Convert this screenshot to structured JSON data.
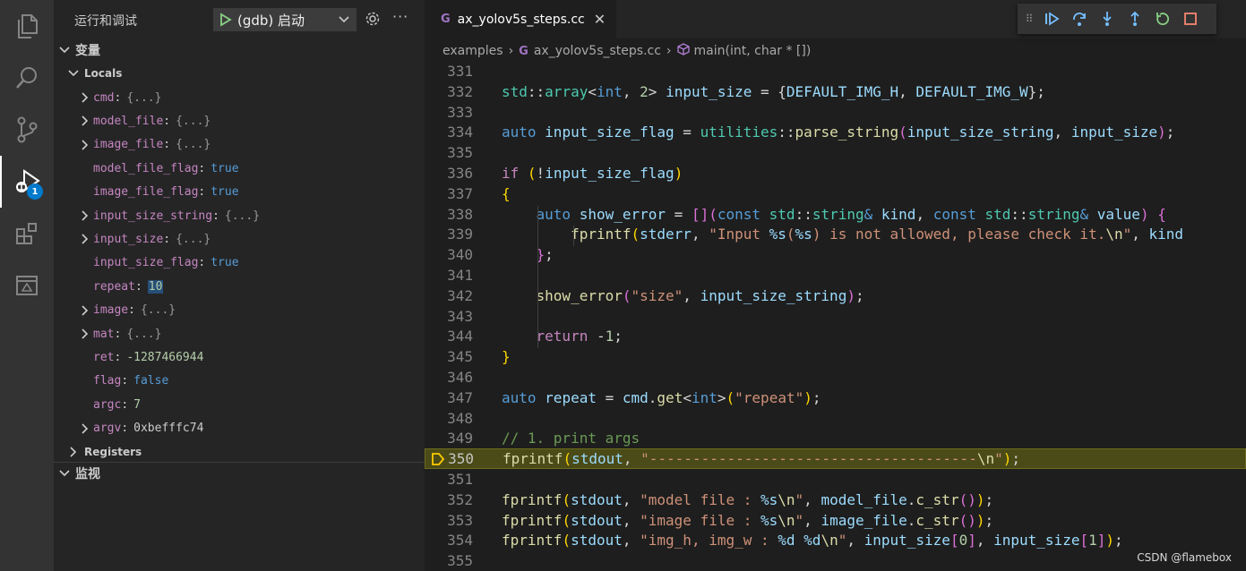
{
  "activity": {
    "icons": [
      "explorer-icon",
      "search-icon",
      "source-control-icon",
      "run-debug-icon",
      "extensions-icon",
      "remote-explorer-icon"
    ],
    "badge": "1"
  },
  "sidebar": {
    "title": "运行和调试",
    "launch_config": "(gdb) 启动",
    "more": "···",
    "variables_header": "变量",
    "locals_header": "Locals",
    "registers_header": "Registers",
    "watch_header": "监视",
    "locals": [
      {
        "name": "cmd",
        "value": "{...}",
        "kind": "obj",
        "expandable": true
      },
      {
        "name": "model_file",
        "value": "{...}",
        "kind": "obj",
        "expandable": true
      },
      {
        "name": "image_file",
        "value": "{...}",
        "kind": "obj",
        "expandable": true
      },
      {
        "name": "model_file_flag",
        "value": "true",
        "kind": "bool",
        "expandable": false
      },
      {
        "name": "image_file_flag",
        "value": "true",
        "kind": "bool",
        "expandable": false
      },
      {
        "name": "input_size_string",
        "value": "{...}",
        "kind": "obj",
        "expandable": true
      },
      {
        "name": "input_size",
        "value": "{...}",
        "kind": "obj",
        "expandable": true
      },
      {
        "name": "input_size_flag",
        "value": "true",
        "kind": "bool",
        "expandable": false
      },
      {
        "name": "repeat",
        "value": "10",
        "kind": "num-hl",
        "expandable": false
      },
      {
        "name": "image",
        "value": "{...}",
        "kind": "obj",
        "expandable": true
      },
      {
        "name": "mat",
        "value": "{...}",
        "kind": "obj",
        "expandable": true
      },
      {
        "name": "ret",
        "value": "-1287466944",
        "kind": "num",
        "expandable": false
      },
      {
        "name": "flag",
        "value": "false",
        "kind": "bool",
        "expandable": false
      },
      {
        "name": "argc",
        "value": "7",
        "kind": "num",
        "expandable": false
      },
      {
        "name": "argv",
        "value": "0xbefffc74",
        "kind": "plain",
        "expandable": true
      }
    ]
  },
  "editor": {
    "tab_label": "ax_yolov5s_steps.cc",
    "tab_icon": "G",
    "breadcrumbs": [
      "examples",
      "ax_yolov5s_steps.cc",
      "main(int, char * [])"
    ],
    "current_line": "350",
    "lines": [
      {
        "num": "331",
        "tokens": []
      },
      {
        "num": "332",
        "tokens": [
          [
            "ns",
            "std"
          ],
          [
            "d",
            "::"
          ],
          [
            "t",
            "array"
          ],
          [
            "d",
            "<"
          ],
          [
            "k",
            "int"
          ],
          [
            "d",
            ", "
          ],
          [
            "n",
            "2"
          ],
          [
            "d",
            "> "
          ],
          [
            "v",
            "input_size"
          ],
          [
            "d",
            " = {"
          ],
          [
            "v",
            "DEFAULT_IMG_H"
          ],
          [
            "d",
            ", "
          ],
          [
            "v",
            "DEFAULT_IMG_W"
          ],
          [
            "d",
            "};"
          ]
        ]
      },
      {
        "num": "333",
        "tokens": []
      },
      {
        "num": "334",
        "tokens": [
          [
            "k",
            "auto"
          ],
          [
            "d",
            " "
          ],
          [
            "v",
            "input_size_flag"
          ],
          [
            "d",
            " = "
          ],
          [
            "ns",
            "utilities"
          ],
          [
            "d",
            "::"
          ],
          [
            "f",
            "parse_string"
          ],
          [
            "br",
            "("
          ],
          [
            "v",
            "input_size_string"
          ],
          [
            "d",
            ", "
          ],
          [
            "v",
            "input_size"
          ],
          [
            "br",
            ")"
          ],
          [
            "d",
            ";"
          ]
        ]
      },
      {
        "num": "335",
        "tokens": []
      },
      {
        "num": "336",
        "tokens": [
          [
            "c",
            "if"
          ],
          [
            "d",
            " "
          ],
          [
            "br2",
            "("
          ],
          [
            "d",
            "!"
          ],
          [
            "v",
            "input_size_flag"
          ],
          [
            "br2",
            ")"
          ]
        ]
      },
      {
        "num": "337",
        "tokens": [
          [
            "br2",
            "{"
          ]
        ]
      },
      {
        "num": "338",
        "tokens": [
          [
            "d",
            "    "
          ],
          [
            "k",
            "auto"
          ],
          [
            "d",
            " "
          ],
          [
            "v",
            "show_error"
          ],
          [
            "d",
            " = "
          ],
          [
            "br",
            "[]"
          ],
          [
            "br",
            "("
          ],
          [
            "k",
            "const"
          ],
          [
            "d",
            " "
          ],
          [
            "ns",
            "std"
          ],
          [
            "d",
            "::"
          ],
          [
            "t",
            "string"
          ],
          [
            "k",
            "&"
          ],
          [
            "d",
            " "
          ],
          [
            "v",
            "kind"
          ],
          [
            "d",
            ", "
          ],
          [
            "k",
            "const"
          ],
          [
            "d",
            " "
          ],
          [
            "ns",
            "std"
          ],
          [
            "d",
            "::"
          ],
          [
            "t",
            "string"
          ],
          [
            "k",
            "&"
          ],
          [
            "d",
            " "
          ],
          [
            "v",
            "value"
          ],
          [
            "br",
            ")"
          ],
          [
            "d",
            " "
          ],
          [
            "br",
            "{"
          ]
        ]
      },
      {
        "num": "339",
        "tokens": [
          [
            "d",
            "        "
          ],
          [
            "f",
            "fprintf"
          ],
          [
            "br2",
            "("
          ],
          [
            "v",
            "stderr"
          ],
          [
            "d",
            ", "
          ],
          [
            "s",
            "\"Input "
          ],
          [
            "v",
            "%s"
          ],
          [
            "s",
            "("
          ],
          [
            "v",
            "%s"
          ],
          [
            "s",
            ") is not allowed, please check it."
          ],
          [
            "f",
            "\\n"
          ],
          [
            "s",
            "\""
          ],
          [
            "d",
            ", "
          ],
          [
            "v",
            "kind"
          ]
        ]
      },
      {
        "num": "340",
        "tokens": [
          [
            "d",
            "    "
          ],
          [
            "br",
            "}"
          ],
          [
            "d",
            ";"
          ]
        ]
      },
      {
        "num": "341",
        "tokens": []
      },
      {
        "num": "342",
        "tokens": [
          [
            "d",
            "    "
          ],
          [
            "f",
            "show_error"
          ],
          [
            "br",
            "("
          ],
          [
            "s",
            "\"size\""
          ],
          [
            "d",
            ", "
          ],
          [
            "v",
            "input_size_string"
          ],
          [
            "br",
            ")"
          ],
          [
            "d",
            ";"
          ]
        ]
      },
      {
        "num": "343",
        "tokens": []
      },
      {
        "num": "344",
        "tokens": [
          [
            "d",
            "    "
          ],
          [
            "c",
            "return"
          ],
          [
            "d",
            " -"
          ],
          [
            "n",
            "1"
          ],
          [
            "d",
            ";"
          ]
        ]
      },
      {
        "num": "345",
        "tokens": [
          [
            "br2",
            "}"
          ]
        ]
      },
      {
        "num": "346",
        "tokens": []
      },
      {
        "num": "347",
        "tokens": [
          [
            "k",
            "auto"
          ],
          [
            "d",
            " "
          ],
          [
            "v",
            "repeat"
          ],
          [
            "d",
            " = "
          ],
          [
            "v",
            "cmd"
          ],
          [
            "d",
            "."
          ],
          [
            "f",
            "get"
          ],
          [
            "d",
            "<"
          ],
          [
            "k",
            "int"
          ],
          [
            "d",
            ">"
          ],
          [
            "br2",
            "("
          ],
          [
            "s",
            "\"repeat\""
          ],
          [
            "br2",
            ")"
          ],
          [
            "d",
            ";"
          ]
        ]
      },
      {
        "num": "348",
        "tokens": []
      },
      {
        "num": "349",
        "tokens": [
          [
            "cm",
            "// 1. print args"
          ]
        ]
      },
      {
        "num": "350",
        "tokens": [
          [
            "f",
            "fprintf"
          ],
          [
            "br2",
            "("
          ],
          [
            "v",
            "stdout"
          ],
          [
            "d",
            ", "
          ],
          [
            "s",
            "\"--------------------------------------"
          ],
          [
            "f",
            "\\n"
          ],
          [
            "s",
            "\""
          ],
          [
            "br2",
            ")"
          ],
          [
            "d",
            ";"
          ]
        ]
      },
      {
        "num": "351",
        "tokens": []
      },
      {
        "num": "352",
        "tokens": [
          [
            "f",
            "fprintf"
          ],
          [
            "br2",
            "("
          ],
          [
            "v",
            "stdout"
          ],
          [
            "d",
            ", "
          ],
          [
            "s",
            "\"model file : "
          ],
          [
            "v",
            "%s"
          ],
          [
            "f",
            "\\n"
          ],
          [
            "s",
            "\""
          ],
          [
            "d",
            ", "
          ],
          [
            "v",
            "model_file"
          ],
          [
            "d",
            "."
          ],
          [
            "f",
            "c_str"
          ],
          [
            "br",
            "()"
          ],
          [
            "br2",
            ")"
          ],
          [
            "d",
            ";"
          ]
        ]
      },
      {
        "num": "353",
        "tokens": [
          [
            "f",
            "fprintf"
          ],
          [
            "br2",
            "("
          ],
          [
            "v",
            "stdout"
          ],
          [
            "d",
            ", "
          ],
          [
            "s",
            "\"image file : "
          ],
          [
            "v",
            "%s"
          ],
          [
            "f",
            "\\n"
          ],
          [
            "s",
            "\""
          ],
          [
            "d",
            ", "
          ],
          [
            "v",
            "image_file"
          ],
          [
            "d",
            "."
          ],
          [
            "f",
            "c_str"
          ],
          [
            "br",
            "()"
          ],
          [
            "br2",
            ")"
          ],
          [
            "d",
            ";"
          ]
        ]
      },
      {
        "num": "354",
        "tokens": [
          [
            "f",
            "fprintf"
          ],
          [
            "br2",
            "("
          ],
          [
            "v",
            "stdout"
          ],
          [
            "d",
            ", "
          ],
          [
            "s",
            "\"img_h, img_w : "
          ],
          [
            "v",
            "%d"
          ],
          [
            "s",
            " "
          ],
          [
            "v",
            "%d"
          ],
          [
            "f",
            "\\n"
          ],
          [
            "s",
            "\""
          ],
          [
            "d",
            ", "
          ],
          [
            "v",
            "input_size"
          ],
          [
            "br",
            "["
          ],
          [
            "n",
            "0"
          ],
          [
            "br",
            "]"
          ],
          [
            "d",
            ", "
          ],
          [
            "v",
            "input_size"
          ],
          [
            "br",
            "["
          ],
          [
            "n",
            "1"
          ],
          [
            "br",
            "]"
          ],
          [
            "br2",
            ")"
          ],
          [
            "d",
            ";"
          ]
        ]
      },
      {
        "num": "355",
        "tokens": []
      }
    ]
  },
  "watermark": "CSDN @flamebox"
}
